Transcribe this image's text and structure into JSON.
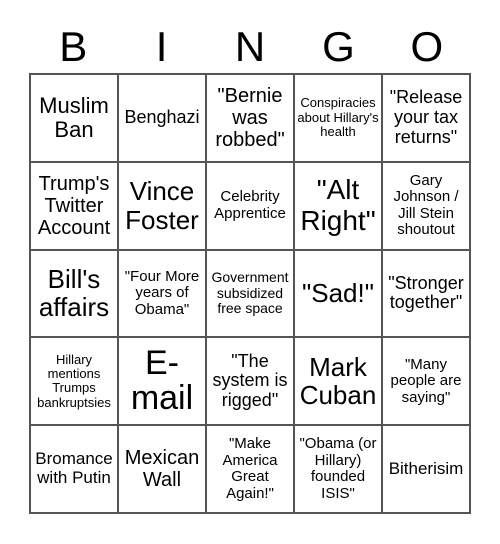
{
  "header": {
    "letters": [
      "B",
      "I",
      "N",
      "G",
      "O"
    ]
  },
  "cells": [
    [
      "Muslim Ban",
      "Benghazi",
      "\"Bernie was robbed\"",
      "Conspiracies about Hillary's health",
      "\"Release your tax returns\""
    ],
    [
      "Trump's Twitter Account",
      "Vince Foster",
      "Celebrity Apprentice",
      "\"Alt Right\"",
      "Gary Johnson / Jill Stein shoutout"
    ],
    [
      "Bill's affairs",
      "\"Four More years of Obama\"",
      "Government subsidized free space",
      "\"Sad!\"",
      "\"Stronger together\""
    ],
    [
      "Hillary mentions Trumps bankruptsies",
      "E-mail",
      "\"The system is rigged\"",
      "Mark Cuban",
      "\"Many people are saying\""
    ],
    [
      "Bromance with Putin",
      "Mexican Wall",
      "\"Make America Great Again!\"",
      "\"Obama (or Hillary) founded ISIS\"",
      "Bitherisim"
    ]
  ]
}
